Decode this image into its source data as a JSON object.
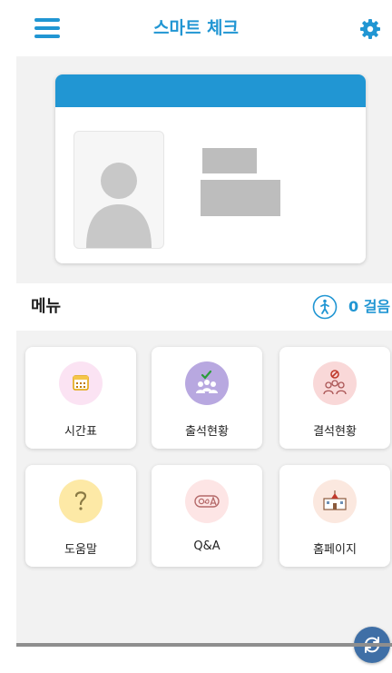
{
  "header": {
    "title": "스마트 체크",
    "menu_icon": "hamburger-menu-icon",
    "settings_icon": "gear-icon"
  },
  "menu_section": {
    "label": "메뉴",
    "steps_icon": "walking-person-icon",
    "steps_text": "0 걸음"
  },
  "tiles": [
    {
      "label": "시간표",
      "icon": "calendar-icon",
      "circle_color": "#fbe3f3"
    },
    {
      "label": "출석현황",
      "icon": "attendance-check-icon",
      "circle_color": "#b8a8e0"
    },
    {
      "label": "결석현황",
      "icon": "absence-icon",
      "circle_color": "#f9d8d8"
    },
    {
      "label": "도움말",
      "icon": "question-mark-icon",
      "circle_color": "#fde9a6"
    },
    {
      "label": "Q&A",
      "icon": "qna-icon",
      "circle_color": "#fde5e5"
    },
    {
      "label": "홈페이지",
      "icon": "school-building-icon",
      "circle_color": "#fbe8df"
    }
  ],
  "colors": {
    "accent": "#2196d3",
    "background": "#f2f2f2",
    "refresh_button": "#3f6fa6"
  },
  "refresh_icon": "refresh-icon"
}
